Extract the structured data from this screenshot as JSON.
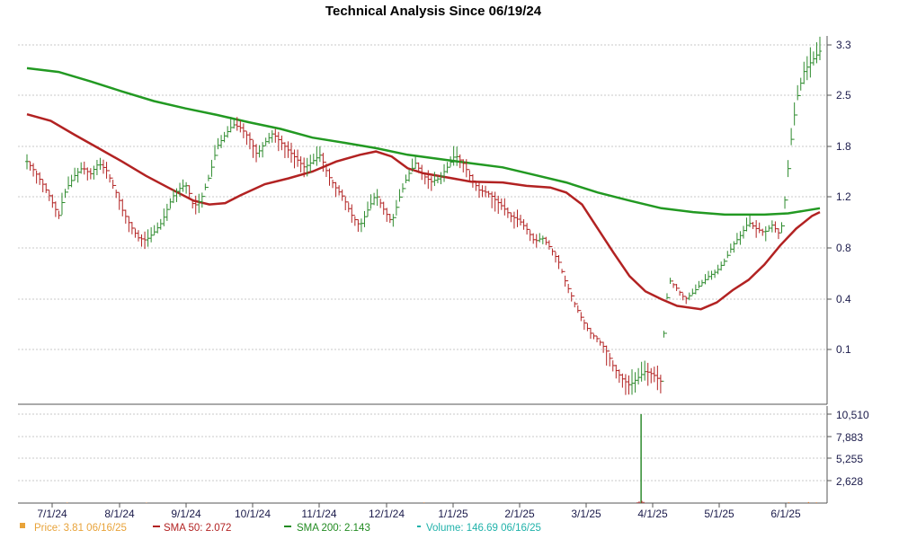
{
  "chart_data": {
    "type": "ohlc",
    "title": "Technical Analysis Since 06/19/24",
    "price_axis": {
      "ticks": [
        3.3,
        2.5,
        1.8,
        1.2,
        0.8,
        0.4,
        0.1
      ],
      "labels": [
        "3.3",
        "2.5",
        "1.8",
        "1.2",
        "0.8",
        "0.4",
        "0.1"
      ]
    },
    "volume_axis": {
      "ticks": [
        10510,
        7883,
        5255,
        2628
      ],
      "labels": [
        "10,510",
        "7,883",
        "5,255",
        "2,628"
      ]
    },
    "x_tick_labels": [
      "7/1/24",
      "8/1/24",
      "9/1/24",
      "10/1/24",
      "11/1/24",
      "12/1/24",
      "1/1/25",
      "2/1/25",
      "3/1/25",
      "4/1/25",
      "5/1/25",
      "6/1/25"
    ],
    "grid": true,
    "legend_position": "bottom",
    "legend": [
      {
        "marker": "square",
        "color": "#e8a33a",
        "text": "Price: 3.81  06/16/25"
      },
      {
        "marker": "line",
        "color": "#b22222",
        "text": "SMA 50: 2.072"
      },
      {
        "marker": "line",
        "color": "#228b22",
        "text": "SMA 200: 2.143"
      },
      {
        "marker": "dash",
        "color": "#20b2aa",
        "text": "Volume: 146.69  06/16/25"
      }
    ],
    "sma200": [
      [
        0,
        2.93
      ],
      [
        0.04,
        2.87
      ],
      [
        0.08,
        2.72
      ],
      [
        0.12,
        2.56
      ],
      [
        0.16,
        2.42
      ],
      [
        0.2,
        2.32
      ],
      [
        0.24,
        2.23
      ],
      [
        0.28,
        2.13
      ],
      [
        0.32,
        2.04
      ],
      [
        0.36,
        1.92
      ],
      [
        0.4,
        1.85
      ],
      [
        0.44,
        1.78
      ],
      [
        0.48,
        1.7
      ],
      [
        0.52,
        1.65
      ],
      [
        0.56,
        1.6
      ],
      [
        0.6,
        1.55
      ],
      [
        0.64,
        1.46
      ],
      [
        0.68,
        1.37
      ],
      [
        0.72,
        1.25
      ],
      [
        0.76,
        1.17
      ],
      [
        0.8,
        1.11
      ],
      [
        0.84,
        1.08
      ],
      [
        0.88,
        1.06
      ],
      [
        0.9,
        1.06
      ],
      [
        0.93,
        1.06
      ],
      [
        0.96,
        1.07
      ],
      [
        0.98,
        1.09
      ],
      [
        1.0,
        1.11
      ]
    ],
    "sma50": [
      [
        0,
        2.24
      ],
      [
        0.03,
        2.15
      ],
      [
        0.06,
        1.96
      ],
      [
        0.09,
        1.78
      ],
      [
        0.12,
        1.62
      ],
      [
        0.15,
        1.45
      ],
      [
        0.18,
        1.3
      ],
      [
        0.21,
        1.17
      ],
      [
        0.23,
        1.14
      ],
      [
        0.25,
        1.15
      ],
      [
        0.27,
        1.22
      ],
      [
        0.3,
        1.35
      ],
      [
        0.33,
        1.42
      ],
      [
        0.36,
        1.5
      ],
      [
        0.39,
        1.62
      ],
      [
        0.42,
        1.7
      ],
      [
        0.44,
        1.74
      ],
      [
        0.46,
        1.68
      ],
      [
        0.48,
        1.54
      ],
      [
        0.5,
        1.48
      ],
      [
        0.53,
        1.43
      ],
      [
        0.56,
        1.38
      ],
      [
        0.6,
        1.37
      ],
      [
        0.63,
        1.33
      ],
      [
        0.66,
        1.31
      ],
      [
        0.68,
        1.25
      ],
      [
        0.7,
        1.14
      ],
      [
        0.72,
        0.95
      ],
      [
        0.74,
        0.76
      ],
      [
        0.76,
        0.58
      ],
      [
        0.78,
        0.46
      ],
      [
        0.8,
        0.4
      ],
      [
        0.82,
        0.36
      ],
      [
        0.85,
        0.34
      ],
      [
        0.87,
        0.38
      ],
      [
        0.89,
        0.47
      ],
      [
        0.91,
        0.55
      ],
      [
        0.93,
        0.67
      ],
      [
        0.95,
        0.82
      ],
      [
        0.97,
        0.95
      ],
      [
        0.99,
        1.05
      ],
      [
        1.0,
        1.08
      ]
    ],
    "price": [
      [
        0,
        1.62
      ],
      [
        0.01,
        1.5
      ],
      [
        0.02,
        1.35
      ],
      [
        0.03,
        1.18
      ],
      [
        0.04,
        1.05
      ],
      [
        0.05,
        1.3
      ],
      [
        0.06,
        1.45
      ],
      [
        0.07,
        1.55
      ],
      [
        0.08,
        1.47
      ],
      [
        0.09,
        1.6
      ],
      [
        0.1,
        1.52
      ],
      [
        0.11,
        1.3
      ],
      [
        0.12,
        1.1
      ],
      [
        0.13,
        0.98
      ],
      [
        0.14,
        0.88
      ],
      [
        0.15,
        0.86
      ],
      [
        0.16,
        0.92
      ],
      [
        0.17,
        1.0
      ],
      [
        0.18,
        1.15
      ],
      [
        0.19,
        1.28
      ],
      [
        0.2,
        1.35
      ],
      [
        0.21,
        1.12
      ],
      [
        0.22,
        1.18
      ],
      [
        0.23,
        1.45
      ],
      [
        0.24,
        1.8
      ],
      [
        0.25,
        1.96
      ],
      [
        0.26,
        2.1
      ],
      [
        0.27,
        2.05
      ],
      [
        0.28,
        1.92
      ],
      [
        0.29,
        1.7
      ],
      [
        0.3,
        1.85
      ],
      [
        0.31,
        1.98
      ],
      [
        0.32,
        1.86
      ],
      [
        0.33,
        1.75
      ],
      [
        0.34,
        1.65
      ],
      [
        0.35,
        1.55
      ],
      [
        0.36,
        1.62
      ],
      [
        0.37,
        1.7
      ],
      [
        0.38,
        1.45
      ],
      [
        0.39,
        1.3
      ],
      [
        0.4,
        1.18
      ],
      [
        0.41,
        1.05
      ],
      [
        0.42,
        0.97
      ],
      [
        0.43,
        1.1
      ],
      [
        0.44,
        1.22
      ],
      [
        0.45,
        1.1
      ],
      [
        0.46,
        1.0
      ],
      [
        0.47,
        1.2
      ],
      [
        0.48,
        1.45
      ],
      [
        0.49,
        1.6
      ],
      [
        0.5,
        1.45
      ],
      [
        0.51,
        1.38
      ],
      [
        0.52,
        1.42
      ],
      [
        0.53,
        1.55
      ],
      [
        0.54,
        1.7
      ],
      [
        0.55,
        1.6
      ],
      [
        0.56,
        1.42
      ],
      [
        0.57,
        1.28
      ],
      [
        0.58,
        1.25
      ],
      [
        0.59,
        1.18
      ],
      [
        0.6,
        1.12
      ],
      [
        0.61,
        1.05
      ],
      [
        0.62,
        1.02
      ],
      [
        0.63,
        0.95
      ],
      [
        0.64,
        0.85
      ],
      [
        0.65,
        0.88
      ],
      [
        0.66,
        0.8
      ],
      [
        0.67,
        0.7
      ],
      [
        0.68,
        0.52
      ],
      [
        0.69,
        0.38
      ],
      [
        0.7,
        0.28
      ],
      [
        0.71,
        0.2
      ],
      [
        0.72,
        0.16
      ],
      [
        0.73,
        0.1
      ],
      [
        0.74,
        0.05
      ],
      [
        0.75,
        0.02
      ],
      [
        0.76,
        0.0
      ],
      [
        0.77,
        0.02
      ],
      [
        0.78,
        0.04
      ],
      [
        0.79,
        0.03
      ],
      [
        0.8,
        0.01
      ],
      [
        0.805,
        0.3
      ],
      [
        0.81,
        0.55
      ],
      [
        0.82,
        0.48
      ],
      [
        0.83,
        0.4
      ],
      [
        0.84,
        0.45
      ],
      [
        0.85,
        0.52
      ],
      [
        0.86,
        0.58
      ],
      [
        0.87,
        0.62
      ],
      [
        0.88,
        0.7
      ],
      [
        0.89,
        0.82
      ],
      [
        0.9,
        0.9
      ],
      [
        0.91,
        1.0
      ],
      [
        0.92,
        0.95
      ],
      [
        0.93,
        0.92
      ],
      [
        0.94,
        0.98
      ],
      [
        0.95,
        0.9
      ],
      [
        0.955,
        1.1
      ],
      [
        0.96,
        1.55
      ],
      [
        0.965,
        2.0
      ],
      [
        0.97,
        2.4
      ],
      [
        0.975,
        2.65
      ],
      [
        0.98,
        2.88
      ],
      [
        0.99,
        3.05
      ],
      [
        1.0,
        3.2
      ]
    ],
    "volume_spike": {
      "position": 0.785,
      "value": 10510
    }
  }
}
